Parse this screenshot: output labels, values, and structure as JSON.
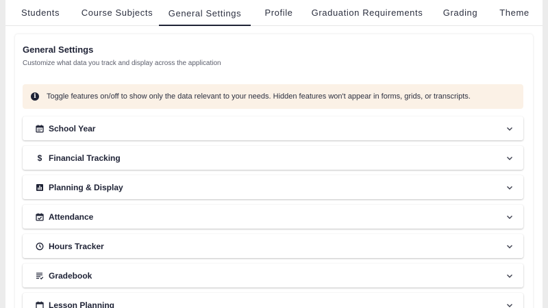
{
  "tabs": [
    {
      "label": "Students"
    },
    {
      "label": "Course Subjects"
    },
    {
      "label": "General Settings",
      "active": true
    },
    {
      "label": "Profile"
    },
    {
      "label": "Graduation Requirements"
    },
    {
      "label": "Grading"
    },
    {
      "label": "Theme"
    }
  ],
  "page": {
    "title": "General Settings",
    "subtitle": "Customize what data you track and display across the application"
  },
  "info_banner": {
    "text": "Toggle features on/off to show only the data relevant to your needs. Hidden features won't appear in forms, grids, or transcripts."
  },
  "sections": [
    {
      "label": "School Year",
      "icon": "calendar-icon"
    },
    {
      "label": "Financial Tracking",
      "icon": "dollar-icon"
    },
    {
      "label": "Planning & Display",
      "icon": "chart-icon"
    },
    {
      "label": "Attendance",
      "icon": "calendar-check-icon"
    },
    {
      "label": "Hours Tracker",
      "icon": "clock-icon"
    },
    {
      "label": "Gradebook",
      "icon": "list-icon"
    },
    {
      "label": "Lesson Planning",
      "icon": "calendar-icon"
    }
  ],
  "colors": {
    "text_primary": "#1e2235",
    "info_background": "#fbf1e6",
    "page_background": "#ececec"
  }
}
